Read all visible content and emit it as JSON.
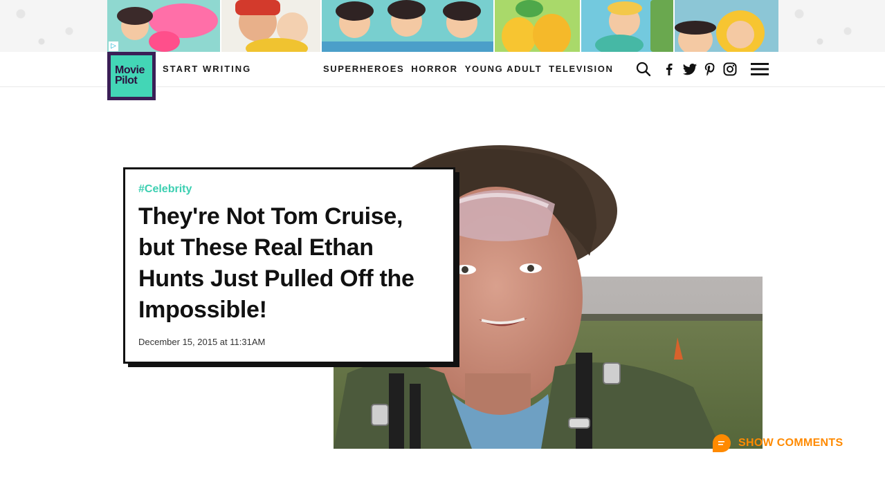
{
  "ad": {
    "choices_icon": "adchoices-icon"
  },
  "header": {
    "logo_line1": "Movie",
    "logo_line2": "Pilot",
    "start_writing": "START WRITING",
    "nav": [
      "SUPERHEROES",
      "HORROR",
      "YOUNG ADULT",
      "TELEVISION"
    ],
    "icons": [
      "search-icon",
      "facebook-icon",
      "twitter-icon",
      "pinterest-icon",
      "instagram-icon",
      "menu-icon"
    ]
  },
  "article": {
    "tag": "#Celebrity",
    "title": "They're Not Tom Cruise, but These Real Ethan Hunts Just Pulled Off the Impossible!",
    "date": "December 15, 2015 at 11:31AM"
  },
  "comments": {
    "label": "SHOW COMMENTS"
  },
  "colors": {
    "brand_teal": "#43d6b6",
    "brand_purple": "#3a1f56",
    "tag_teal": "#3ccfb1",
    "comments_orange": "#ff8a00"
  }
}
